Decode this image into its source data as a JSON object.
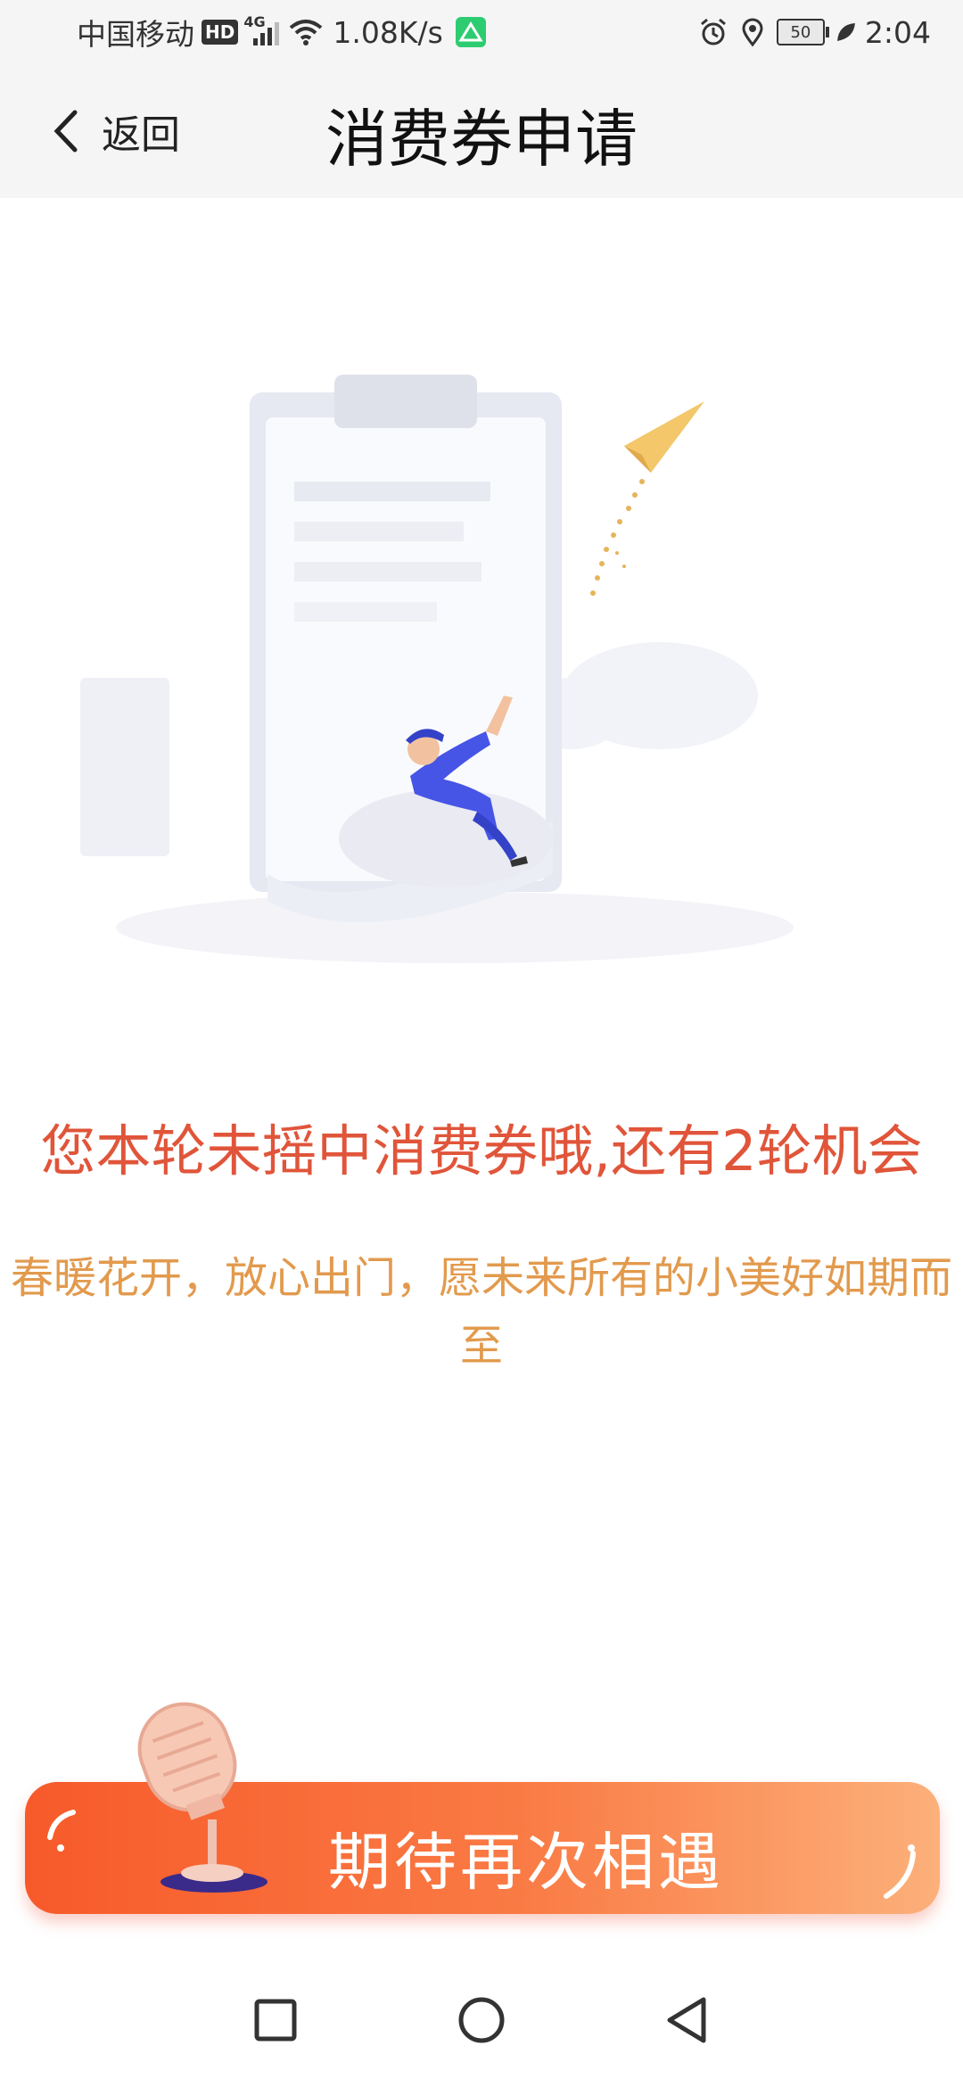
{
  "status_bar": {
    "carrier": "中国移动",
    "hd": "HD",
    "network": "4G",
    "net_speed": "1.08K/s",
    "battery": "50",
    "time": "2:04"
  },
  "header": {
    "back_label": "返回",
    "title": "消费券申请"
  },
  "content": {
    "main_message": "您本轮未摇中消费券哦,还有2轮机会",
    "sub_message": "春暖花开，放心出门，愿未来所有的小美好如期而至"
  },
  "action": {
    "label": "期待再次相遇"
  },
  "colors": {
    "main_message": "#e0553a",
    "sub_message": "#e29a4d",
    "button_start": "#f75a2a",
    "button_end": "#fcb07a",
    "figure_blue": "#4655e6"
  }
}
